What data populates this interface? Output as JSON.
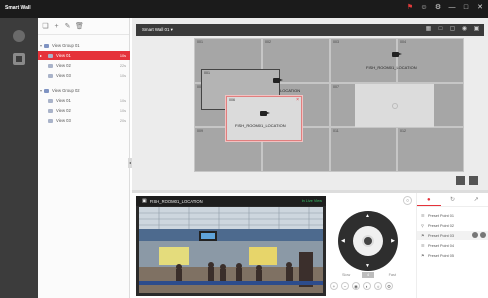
{
  "app": {
    "title": "Smart Wall"
  },
  "titlebar": {
    "icons": [
      "alarm-icon",
      "user-icon",
      "settings-icon",
      "minimize-icon",
      "maximize-icon",
      "close-icon"
    ]
  },
  "nav": {
    "items": [
      "live-view-icon",
      "smart-wall-icon"
    ]
  },
  "tree": {
    "toolbar": [
      "folder-add-icon",
      "add-icon",
      "edit-icon",
      "delete-icon"
    ],
    "rows": [
      {
        "label": "View Group 01",
        "meta": "",
        "level": 0,
        "type": "group"
      },
      {
        "label": "View 01",
        "meta": "10s",
        "level": 1,
        "type": "view",
        "selected": true
      },
      {
        "label": "View 02",
        "meta": "22s",
        "level": 1,
        "type": "view"
      },
      {
        "label": "View 03",
        "meta": "10s",
        "level": 1,
        "type": "view"
      },
      {
        "label": "View Group 02",
        "meta": "",
        "level": 0,
        "type": "group"
      },
      {
        "label": "View 01",
        "meta": "10s",
        "level": 1,
        "type": "view"
      },
      {
        "label": "View 02",
        "meta": "10s",
        "level": 1,
        "type": "view"
      },
      {
        "label": "View 03",
        "meta": "20s",
        "level": 1,
        "type": "view"
      }
    ]
  },
  "wall": {
    "name": "Smart Wall 01",
    "screens": [
      "001",
      "002",
      "003",
      "004",
      "005",
      "006",
      "007",
      "008",
      "009",
      "010",
      "011",
      "012"
    ],
    "windows": [
      {
        "num": "001",
        "label": "LOCATION"
      },
      {
        "num": "006",
        "label": "FISH_ROOM01_LOCATION"
      },
      {
        "num": "004",
        "label": "FISH_ROOM01_LOCATION"
      }
    ]
  },
  "preview": {
    "title": "FISH_ROOM01_LOCATION",
    "status": "In Live View"
  },
  "ptz": {
    "speed_min": "Slow",
    "speed_value": "4",
    "speed_max": "Fast"
  },
  "presets": {
    "items": [
      "Preset Point 01",
      "Preset Point 02",
      "Preset Point 03",
      "Preset Point 04",
      "Preset Point 05"
    ]
  }
}
